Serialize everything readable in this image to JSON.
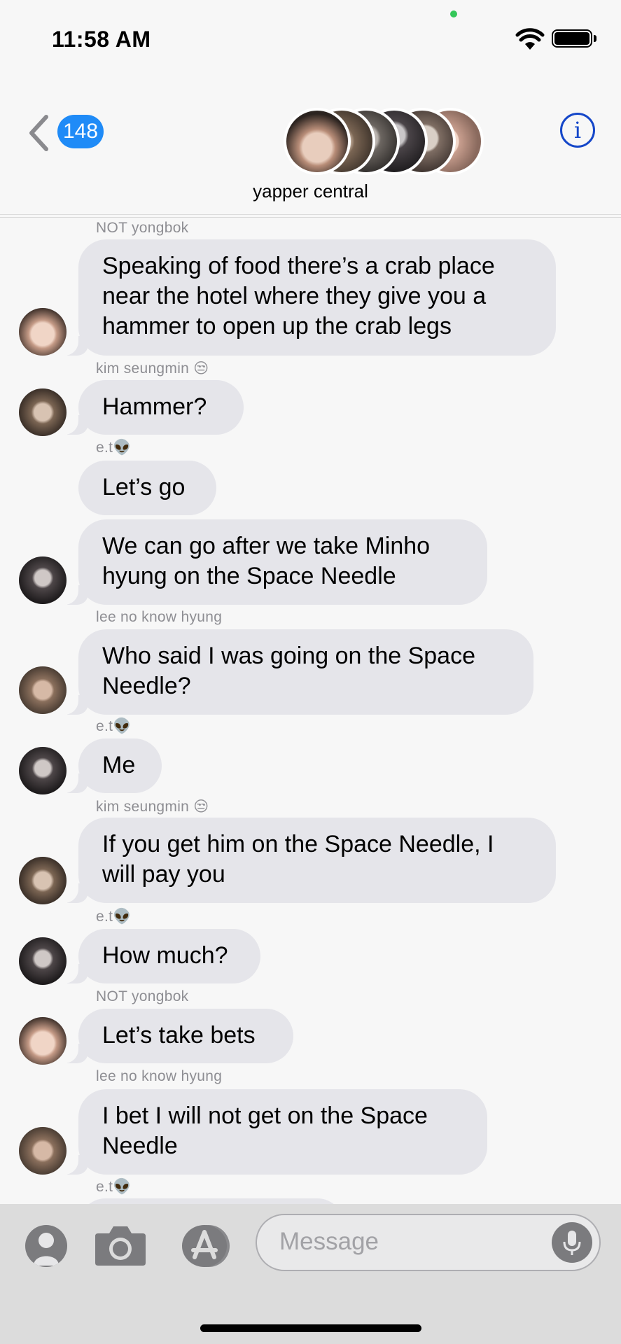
{
  "status_bar": {
    "time": "11:58 AM"
  },
  "header": {
    "back_count": "148",
    "group_name": "yapper central"
  },
  "messages": [
    {
      "sender": "NOT yongbok",
      "text": "Speaking of food there’s a crab place near the hotel where they give you a hammer to open up the crab legs"
    },
    {
      "sender": "kim seungmin 😒",
      "text": "Hammer?"
    },
    {
      "sender": "e.t👽",
      "text": "Let’s go"
    },
    {
      "text": "We can go after we take Minho hyung on the Space Needle"
    },
    {
      "sender": "lee no know hyung",
      "text": "Who said I was going on the Space Needle?"
    },
    {
      "sender": "e.t👽",
      "text": "Me"
    },
    {
      "sender": "kim seungmin 😒",
      "text": "If you get him on the Space Needle, I will pay you"
    },
    {
      "sender": "e.t👽",
      "text": "How much?"
    },
    {
      "sender": "NOT yongbok",
      "text": "Let’s take bets"
    },
    {
      "sender": "lee no know hyung",
      "text": "I bet I will not get on the Space Needle"
    },
    {
      "sender": "e.t👽"
    }
  ],
  "input": {
    "placeholder": "Message"
  },
  "icons": {
    "back": "chevron-left-icon",
    "info": "info-icon",
    "contact": "contact-icon",
    "camera": "camera-icon",
    "app_store": "app-store-icon",
    "mic": "microphone-icon"
  },
  "colors": {
    "accent": "#1f8bf7",
    "bubble": "#e5e5ea",
    "sender_label": "#8e8e93",
    "info": "#1547c9"
  }
}
